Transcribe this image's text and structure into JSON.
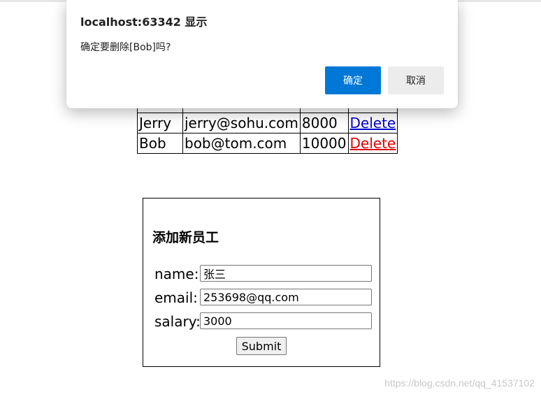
{
  "dialog": {
    "title": "localhost:63342 显示",
    "message": "确定要删除[Bob]吗?",
    "ok_label": "确定",
    "cancel_label": "取消"
  },
  "table": {
    "rows": [
      {
        "name": "Jerry",
        "email": "jerry@sohu.com",
        "salary": "8000",
        "action": "Delete"
      },
      {
        "name": "Bob",
        "email": "bob@tom.com",
        "salary": "10000",
        "action": "Delete"
      }
    ]
  },
  "form": {
    "heading": "添加新员工",
    "name_label": "name:",
    "name_value": "张三",
    "email_label": "email:",
    "email_value": "253698@qq.com",
    "salary_label": "salary:",
    "salary_value": "3000",
    "submit_label": "Submit"
  },
  "watermark": "https://blog.csdn.net/qq_41537102",
  "colors": {
    "primary_button": "#0078d7",
    "link": "#0000cc",
    "visited_link": "#e00000"
  }
}
